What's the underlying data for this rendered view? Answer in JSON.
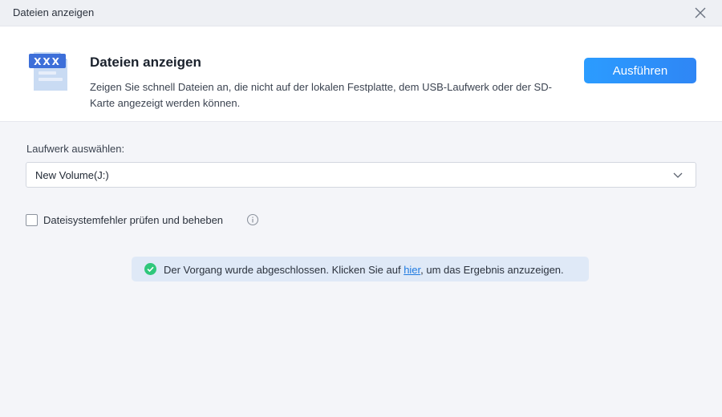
{
  "window": {
    "title": "Dateien anzeigen"
  },
  "header": {
    "icon_text": "XXX",
    "title": "Dateien anzeigen",
    "description": "Zeigen Sie schnell Dateien an, die nicht auf der lokalen Festplatte, dem USB-Laufwerk oder der SD-Karte angezeigt werden können.",
    "run_label": "Ausführen"
  },
  "drive": {
    "label": "Laufwerk auswählen:",
    "selected": "New Volume(J:)"
  },
  "check": {
    "label": "Dateisystemfehler prüfen und beheben",
    "checked": false
  },
  "notice": {
    "before": "Der Vorgang wurde abgeschlossen. Klicken Sie auf ",
    "link": "hier",
    "after": ", um das Ergebnis anzuzeigen."
  },
  "colors": {
    "accent": "#2b9cff",
    "success": "#2fc77b",
    "link": "#1f7ae0",
    "notice_bg": "#dfe9f7"
  },
  "icons": [
    "close-icon",
    "file-view-icon",
    "chevron-down-icon",
    "info-icon",
    "check-circle-icon"
  ]
}
